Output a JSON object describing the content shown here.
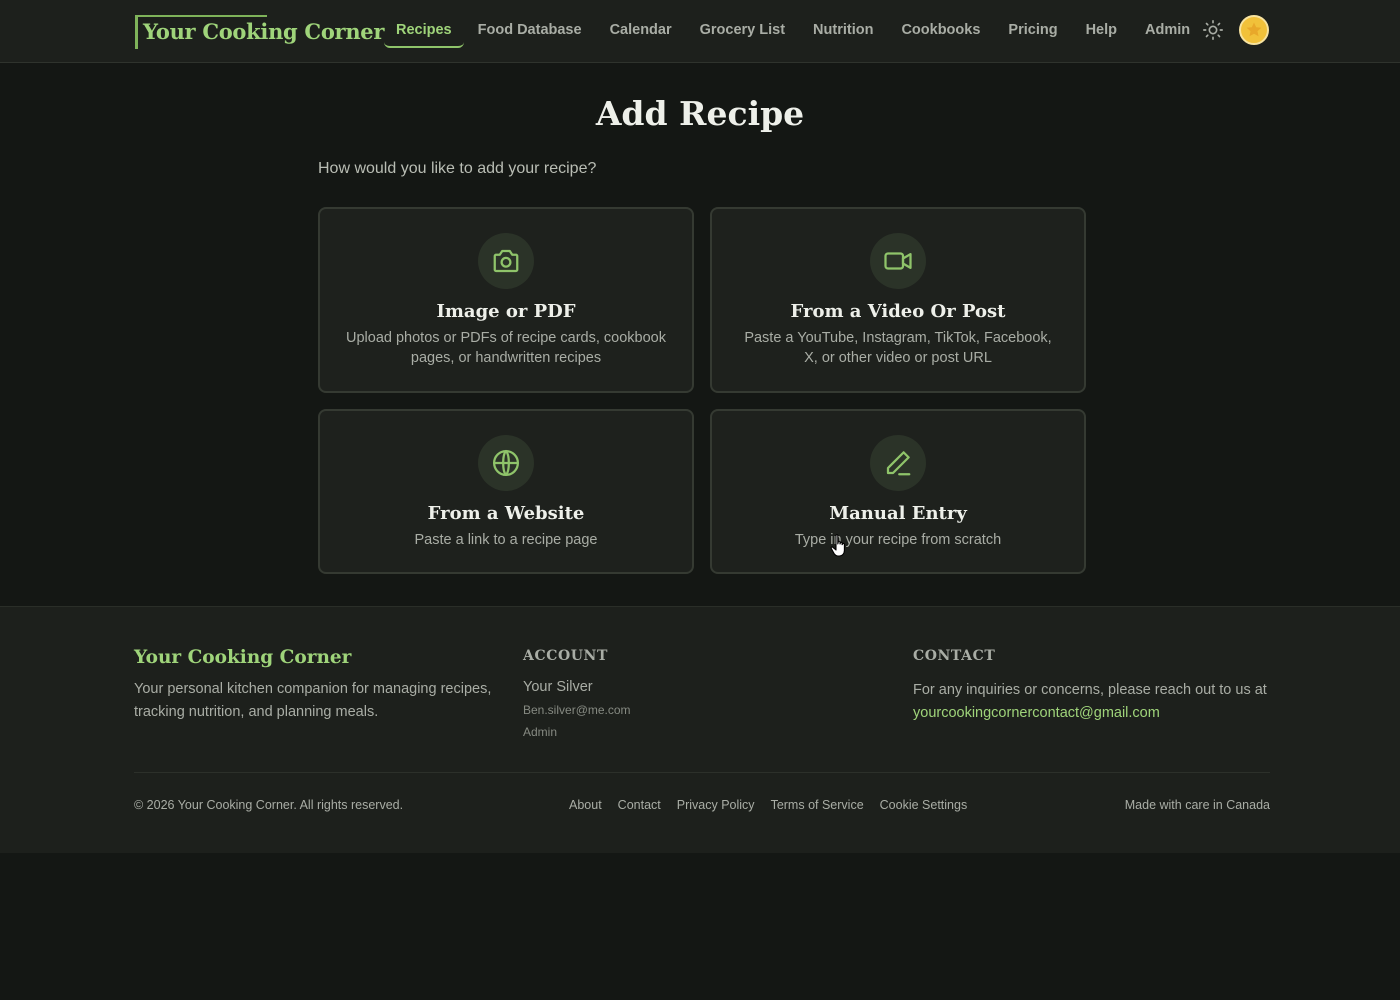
{
  "header": {
    "logo": "Your Cooking Corner",
    "nav": [
      {
        "label": "Recipes",
        "active": true
      },
      {
        "label": "Food Database"
      },
      {
        "label": "Calendar"
      },
      {
        "label": "Grocery List"
      },
      {
        "label": "Nutrition"
      },
      {
        "label": "Cookbooks"
      },
      {
        "label": "Pricing"
      },
      {
        "label": "Help"
      },
      {
        "label": "Admin"
      }
    ],
    "theme_icon": "sun-icon",
    "avatar_icon": "avatar-star-icon"
  },
  "main": {
    "title": "Add Recipe",
    "subtitle": "How would you like to add your recipe?",
    "options": [
      {
        "title": "Image or PDF",
        "desc": "Upload photos or PDFs of recipe cards, cookbook pages, or handwritten recipes",
        "icon": "camera-icon"
      },
      {
        "title": "From a Video Or Post",
        "desc": "Paste a YouTube, Instagram, TikTok, Facebook, X, or other video or post URL",
        "icon": "video-icon"
      },
      {
        "title": "From a Website",
        "desc": "Paste a link to a recipe page",
        "icon": "globe-icon"
      },
      {
        "title": "Manual Entry",
        "desc": "Type in your recipe from scratch",
        "icon": "pencil-icon"
      }
    ]
  },
  "footer": {
    "brand": "Your Cooking Corner",
    "brand_desc": "Your personal kitchen companion for managing recipes, tracking nutrition, and planning meals.",
    "account_heading": "ACCOUNT",
    "account_name": "Your Silver",
    "account_email": "Ben.silver@me.com",
    "account_role": "Admin",
    "contact_heading": "CONTACT",
    "contact_text": "For any inquiries or concerns, please reach out to us at",
    "contact_email": "yourcookingcornercontact@gmail.com",
    "copyright": "© 2026 Your Cooking Corner. All rights reserved.",
    "links": [
      "About",
      "Contact",
      "Privacy Policy",
      "Terms of Service",
      "Cookie Settings"
    ],
    "made_with": "Made with care in Canada"
  },
  "colors": {
    "accent": "#9fd47a",
    "background": "#141714",
    "card": "#1e211d"
  }
}
